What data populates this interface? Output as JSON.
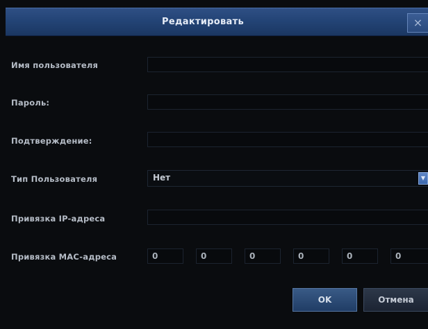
{
  "dialog": {
    "title": "Редактировать",
    "close_glyph": "×"
  },
  "fields": {
    "username_label": "Имя пользователя",
    "password_label": "Пароль:",
    "confirm_label": "Подтверждение:",
    "user_type_label": "Тип Пользователя",
    "user_type_value": "Нет",
    "ip_binding_label": "Привязка IP-адреса",
    "mac_binding_label": "Привязка MAC-адреса",
    "mac_octets": [
      "0",
      "0",
      "0",
      "0",
      "0",
      "0"
    ]
  },
  "buttons": {
    "ok": "OK",
    "cancel": "Отмена"
  },
  "icons": {
    "close": "close-icon",
    "dropdown": "chevron-down-icon"
  }
}
